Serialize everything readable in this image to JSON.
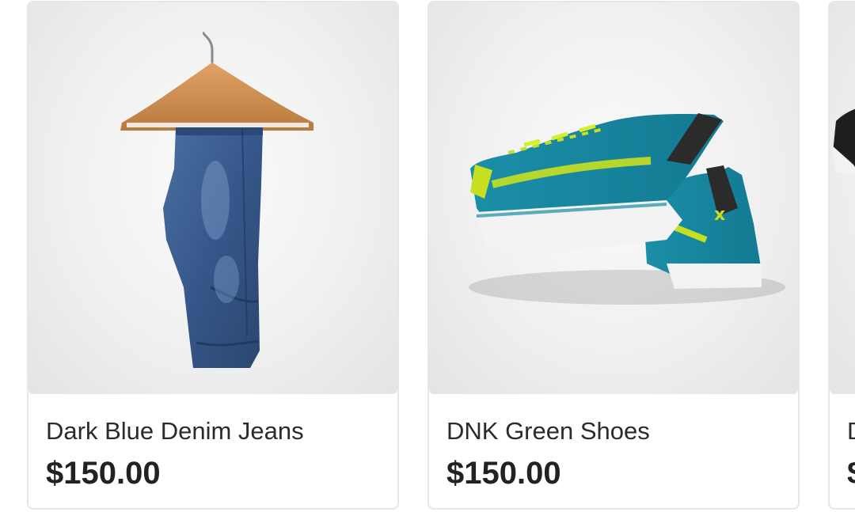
{
  "products": [
    {
      "name": "Dark Blue Denim Jeans",
      "price": "$150.00",
      "image_icon": "jeans-on-hanger-image"
    },
    {
      "name": "DNK Green Shoes",
      "price": "$150.00",
      "image_icon": "green-sneakers-image"
    },
    {
      "name": "D",
      "price": "$",
      "image_icon": "black-shoe-image"
    }
  ],
  "colors": {
    "card_border": "#e6e6e6",
    "text": "#2b2b2b",
    "denim": "#3d5f8f",
    "shoe_teal": "#1a8fa6",
    "shoe_lime": "#c6e021"
  }
}
